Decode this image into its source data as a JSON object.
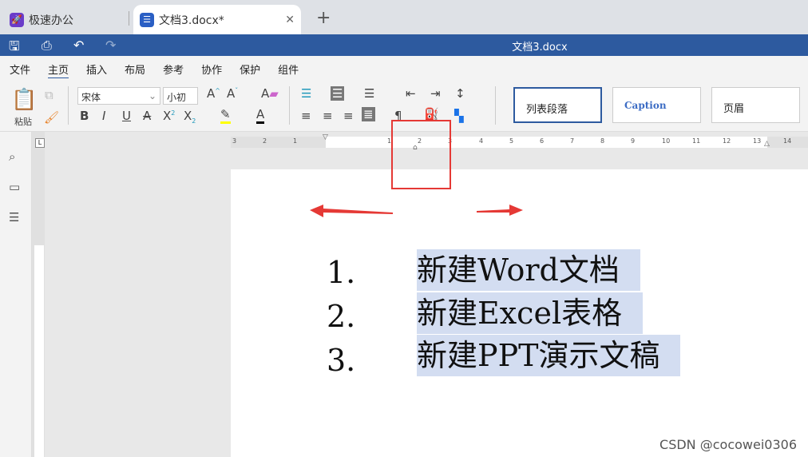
{
  "tabs": [
    {
      "label": "极速办公",
      "icon": "rocket-icon"
    },
    {
      "label": "文档3.docx*",
      "icon": "document-icon"
    }
  ],
  "title": "文档3.docx",
  "menu": [
    "文件",
    "主页",
    "插入",
    "布局",
    "参考",
    "协作",
    "保护",
    "组件"
  ],
  "active_menu": "主页",
  "toolbar": {
    "paste": "粘贴",
    "font": "宋体",
    "size": "小初"
  },
  "styles": [
    "列表段落",
    "Caption",
    "页眉"
  ],
  "ruler_labels": [
    "3",
    "2",
    "1",
    "1",
    "2",
    "3",
    "4",
    "5",
    "6",
    "7",
    "8",
    "9",
    "10",
    "11",
    "12",
    "13",
    "14",
    "15"
  ],
  "list": [
    {
      "num": "1.",
      "text": "新建Word文档"
    },
    {
      "num": "2.",
      "text": "新建Excel表格"
    },
    {
      "num": "3.",
      "text": "新建PPT演示文稿"
    }
  ],
  "watermark": "CSDN @cocowei0306",
  "colors": {
    "brand": "#2d5a9f",
    "highlight": "#d3ddf1",
    "annotation": "#e53935"
  }
}
